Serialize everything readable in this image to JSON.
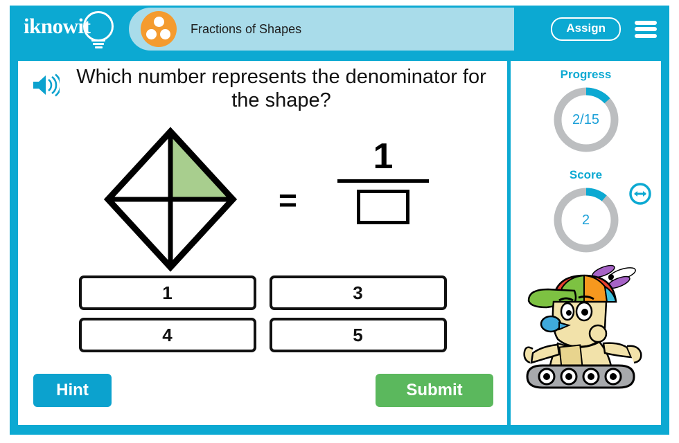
{
  "header": {
    "logo_text": "iknowit",
    "logo_icon": "lightbulb-icon",
    "subject_icon": "three-dots-circle-icon",
    "title": "Fractions of Shapes",
    "assign_label": "Assign",
    "menu_icon": "hamburger-menu-icon"
  },
  "question": {
    "audio_icon": "speaker-icon",
    "text": "Which number represents the denominator for the shape?"
  },
  "figure": {
    "shape_name": "diamond-divided-in-four",
    "total_parts": 4,
    "shaded_parts": 1,
    "shaded_color": "#A8CE8E",
    "outline_color": "#000000",
    "equals_sign": "=",
    "numerator": "1",
    "denominator": ""
  },
  "choices": [
    {
      "label": "1"
    },
    {
      "label": "3"
    },
    {
      "label": "4"
    },
    {
      "label": "5"
    }
  ],
  "actions": {
    "hint_label": "Hint",
    "submit_label": "Submit"
  },
  "sidebar": {
    "progress": {
      "label": "Progress",
      "value_text": "2/15",
      "current": 2,
      "total": 15,
      "arc_color": "#0CA9D2",
      "track_color": "#BCBEC0"
    },
    "score": {
      "label": "Score",
      "value_text": "2",
      "current": 2,
      "arc_color": "#0CA9D2",
      "track_color": "#BCBEC0"
    },
    "mascot_icon": "robot-mascot-with-propeller-cap",
    "resize_icon": "resize-horizontal-icon"
  },
  "colors": {
    "brand_blue": "#0CA9D2",
    "banner_blue": "#A9DCEA",
    "orange": "#F49B2F",
    "green": "#5BB85D",
    "shade_green": "#A8CE8E"
  }
}
